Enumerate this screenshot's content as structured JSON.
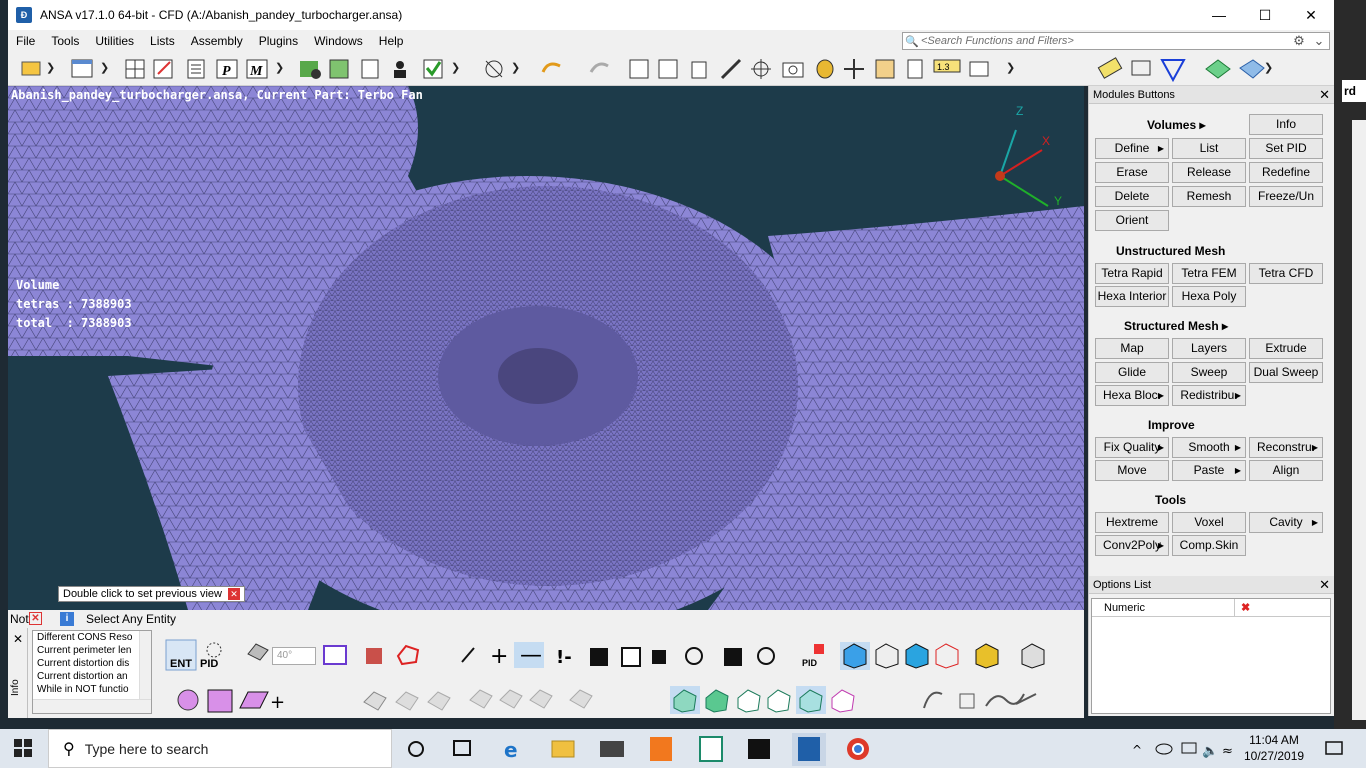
{
  "window": {
    "title": "ANSA v17.1.0 64-bit - CFD (A:/Abanish_pandey_turbocharger.ansa)",
    "app_icon": "ansa-logo-icon",
    "minimize": "—",
    "maximize": "☐",
    "close": "✕"
  },
  "menu": [
    "File",
    "Tools",
    "Utilities",
    "Lists",
    "Assembly",
    "Plugins",
    "Windows",
    "Help"
  ],
  "search": {
    "placeholder": "<Search Functions and Filters>",
    "icon": "magnifier-icon",
    "settings_icon": "gear-icon"
  },
  "viewport": {
    "header": "Abanish_pandey_turbocharger.ansa,  Current Part: Terbo Fan",
    "volume_info": "Volume\ntetras : 7388903\ntotal  : 7388903",
    "hint": "Double click to set previous view",
    "axes": {
      "x": "X",
      "y": "Y",
      "z": "Z"
    },
    "colors": {
      "background": "#1d3b4a",
      "mesh": "#8c86d6",
      "mesh_line": "#3a3a5a"
    }
  },
  "modules": {
    "title": "Modules Buttons",
    "sections": {
      "volumes": "Volumes ▸",
      "unstructured": "Unstructured Mesh",
      "structured": "Structured Mesh ▸",
      "improve": "Improve",
      "tools": "Tools"
    },
    "buttons": {
      "info": "Info",
      "define": "Define",
      "list": "List",
      "set_pid": "Set PID",
      "erase": "Erase",
      "release": "Release",
      "redefine": "Redefine",
      "delete": "Delete",
      "remesh": "Remesh",
      "freeze": "Freeze/Un",
      "orient": "Orient",
      "tetra_rapid": "Tetra Rapid",
      "tetra_fem": "Tetra FEM",
      "tetra_cfd": "Tetra CFD",
      "hexa_interior": "Hexa Interior",
      "hexa_poly": "Hexa Poly",
      "map": "Map",
      "layers": "Layers",
      "extrude": "Extrude",
      "glide": "Glide",
      "sweep": "Sweep",
      "dual_sweep": "Dual Sweep",
      "hexa_block": "Hexa Bloc.",
      "redistribute": "Redistribu.",
      "fix_quality": "Fix Quality",
      "smooth": "Smooth",
      "reconstruct": "Reconstru.",
      "move": "Move",
      "paste": "Paste",
      "align": "Align",
      "hextreme": "Hextreme",
      "voxel": "Voxel",
      "cavity": "Cavity",
      "conv2poly": "Conv2Poly",
      "comp_skin": "Comp.Skin"
    }
  },
  "options": {
    "title": "Options List",
    "rows": [
      {
        "name": "Numeric",
        "value": "✖"
      }
    ]
  },
  "status": {
    "not_label": "Not",
    "select_text": "Select Any Entity"
  },
  "messages": [
    "Different CONS Reso",
    "Current perimeter len",
    "Current distortion dis",
    "Current distortion an",
    "While in NOT functio"
  ],
  "info_label": "Info",
  "bottom_toolbar": {
    "ent": "ENT",
    "pid": "PID",
    "angle": "40°",
    "pid_small": "PID"
  },
  "taskbar": {
    "search_text": "Type here to search",
    "time": "11:04 AM",
    "date": "10/27/2019",
    "pinned": [
      "task-view-icon",
      "edge-icon",
      "file-explorer-icon",
      "mail-icon",
      "sublime-icon",
      "network-app-icon",
      "terminal-icon",
      "ansa-icon",
      "chrome-icon"
    ]
  },
  "right_strip": {
    "fragment": "rd"
  }
}
